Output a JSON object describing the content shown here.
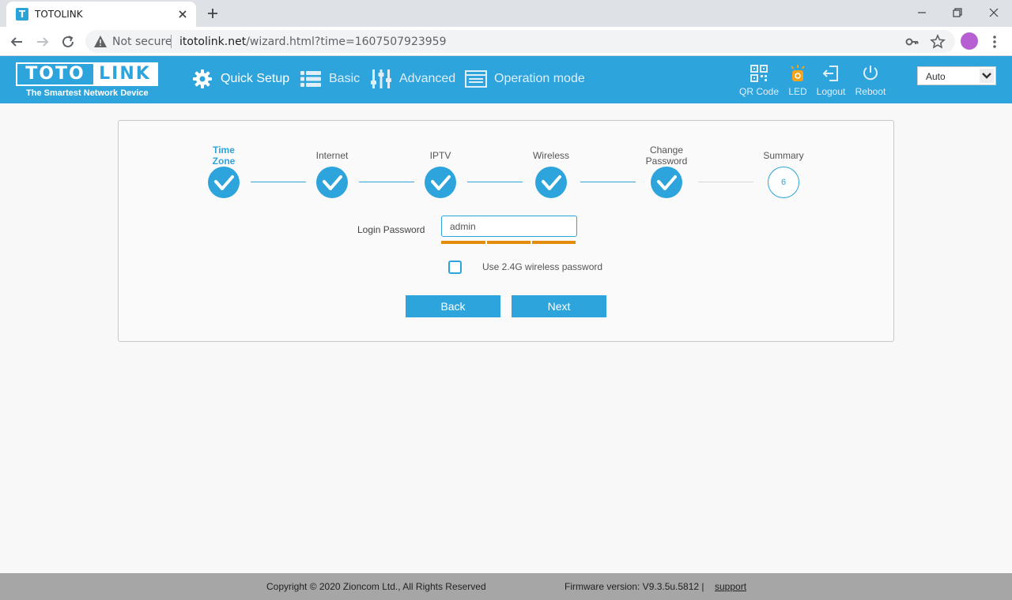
{
  "browser": {
    "tab_title": "TOTOLINK",
    "tab_favicon": "T",
    "security_text": "Not secure",
    "url_host": "itotolink.net",
    "url_path": "/wizard.html?time=1607507923959"
  },
  "header": {
    "logo_left": "TOTO",
    "logo_right": "LINK",
    "tagline": "The Smartest Network Device",
    "nav": [
      {
        "label": "Quick Setup",
        "icon": "gear-icon"
      },
      {
        "label": "Basic",
        "icon": "list-icon"
      },
      {
        "label": "Advanced",
        "icon": "sliders-icon"
      },
      {
        "label": "Operation mode",
        "icon": "window-icon"
      }
    ],
    "tools": [
      {
        "label": "QR Code",
        "icon": "qr-code-icon"
      },
      {
        "label": "LED",
        "icon": "led-icon"
      },
      {
        "label": "Logout",
        "icon": "logout-icon"
      },
      {
        "label": "Reboot",
        "icon": "power-icon"
      }
    ],
    "language": "Auto"
  },
  "wizard": {
    "steps": [
      {
        "line1": "Time",
        "line2": "Zone",
        "status": "done"
      },
      {
        "line1": "Internet",
        "line2": "",
        "status": "done"
      },
      {
        "line1": "IPTV",
        "line2": "",
        "status": "done"
      },
      {
        "line1": "Wireless",
        "line2": "",
        "status": "done"
      },
      {
        "line1": "Change",
        "line2": "Password",
        "status": "done"
      },
      {
        "line1": "Summary",
        "line2": "",
        "status": "todo",
        "number": "6"
      }
    ],
    "password_label": "Login Password",
    "password_value": "admin",
    "checkbox_label": "Use 2.4G wireless password",
    "back_label": "Back",
    "next_label": "Next"
  },
  "footer": {
    "copyright": "Copyright © 2020 Zioncom Ltd., All Rights Reserved",
    "firmware": "Firmware version: V9.3.5u.5812  |",
    "support": "support"
  },
  "colors": {
    "brand": "#2da4dc",
    "strength": "#e38b0b",
    "footer": "#a6a6a6"
  }
}
